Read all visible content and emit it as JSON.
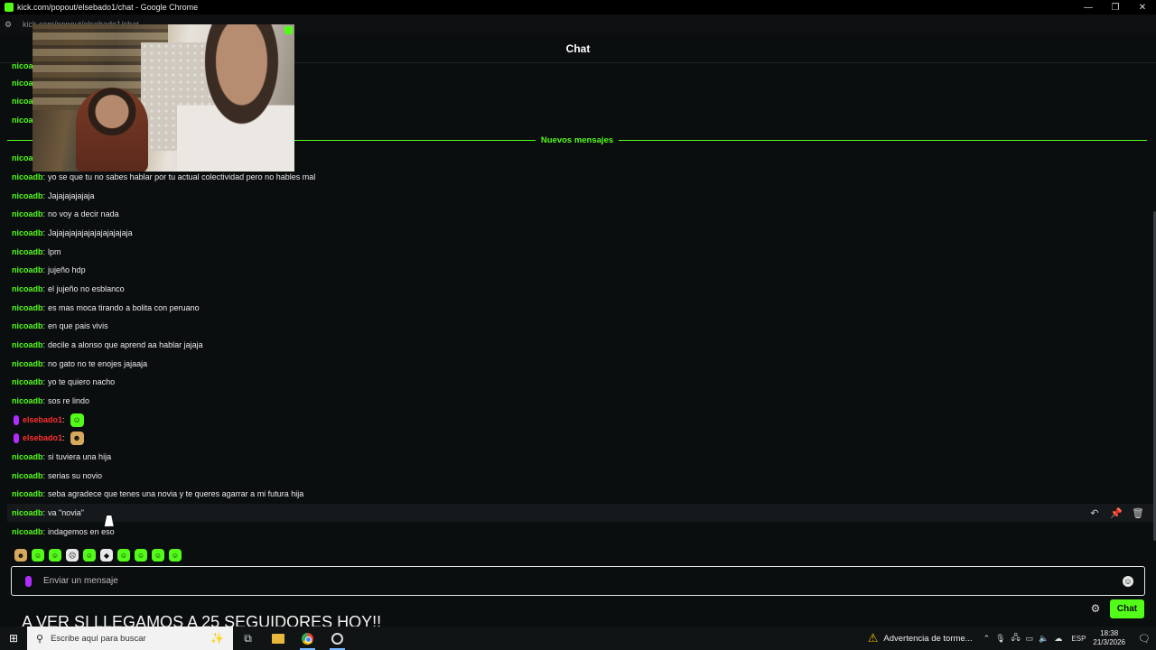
{
  "window": {
    "title": "kick.com/popout/elsebado1/chat - Google Chrome",
    "url": "kick.com/popout/elsebado1/chat",
    "controls": [
      "—",
      "❐",
      "✕"
    ]
  },
  "chat": {
    "header": "Chat",
    "new_messages_label": "Nuevos mensajes",
    "partial_names": [
      "nicoa",
      "nicoa",
      "nicoa",
      "nicoa",
      "nicoa"
    ],
    "messages": [
      {
        "user": "nicoadb",
        "text": "yo se que tu no sabes hablar por tu actual colectividad pero no hables mal"
      },
      {
        "user": "nicoadb",
        "text": "Jajajajajajaja"
      },
      {
        "user": "nicoadb",
        "text": "no voy a decir nada"
      },
      {
        "user": "nicoadb",
        "text": "Jajajajajajajajajajajajaja"
      },
      {
        "user": "nicoadb",
        "text": "lpm"
      },
      {
        "user": "nicoadb",
        "text": "jujeño hdp"
      },
      {
        "user": "nicoadb",
        "text": "el jujeño no esblanco"
      },
      {
        "user": "nicoadb",
        "text": "es mas moca tirando a bolita con peruano"
      },
      {
        "user": "nicoadb",
        "text": "en que pais vivis"
      },
      {
        "user": "nicoadb",
        "text": "decile a alonso que aprend aa hablar jajaja"
      },
      {
        "user": "nicoadb",
        "text": "no gato no te enojes jajaaja"
      },
      {
        "user": "nicoadb",
        "text": "yo te quiero nacho"
      },
      {
        "user": "nicoadb",
        "text": "sos re lindo"
      },
      {
        "user": "elsebado1",
        "text": ":",
        "emote": "green"
      },
      {
        "user": "elsebado1",
        "text": ":",
        "emote": "tan"
      },
      {
        "user": "nicoadb",
        "text": "si tuviera una hija"
      },
      {
        "user": "nicoadb",
        "text": "serias su novio"
      },
      {
        "user": "nicoadb",
        "text": "seba agradece que tenes una novia y te queres agarrar a mi futura hija"
      },
      {
        "user": "nicoadb",
        "text": "va \"novia\""
      },
      {
        "user": "nicoadb",
        "text": "indagemos en eso"
      }
    ],
    "input_placeholder": "Enviar un mensaje",
    "send_button": "Chat",
    "banner": "A VER SI LLEGAMOS A 25 SEGUIDORES HOY!!"
  },
  "taskbar": {
    "search_placeholder": "Escribe aquí para buscar",
    "weather": "Advertencia de torme...",
    "language": "ESP",
    "time": "18:38",
    "date": "21/3/2026"
  },
  "colors": {
    "accent": "#53fc18",
    "background": "#0b0e0f",
    "broadcaster": "#ff2f2f",
    "mic": "#b02dff"
  }
}
